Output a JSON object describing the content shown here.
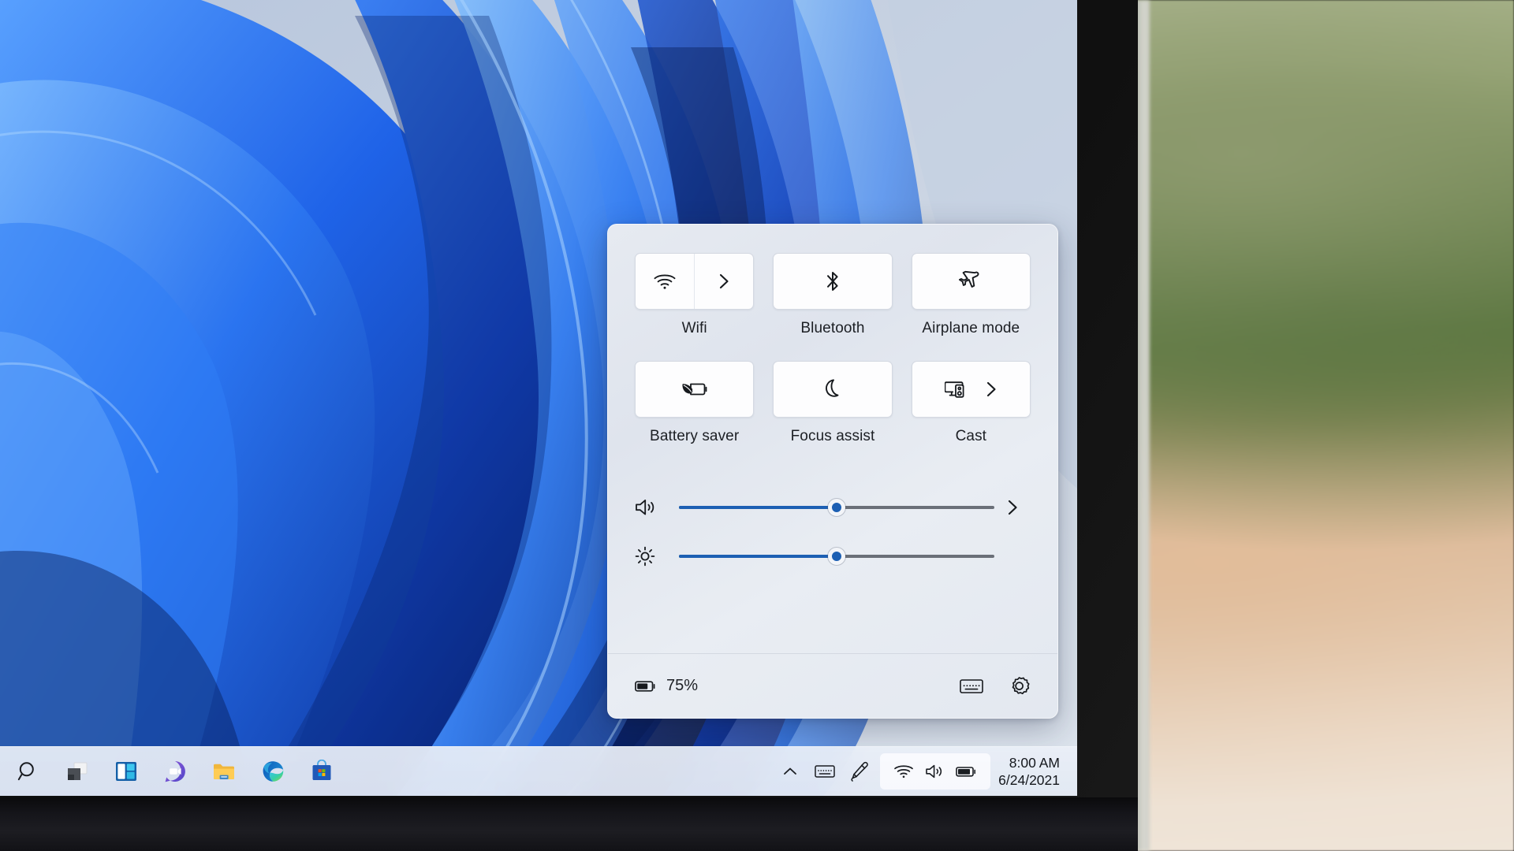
{
  "quick_settings": {
    "tiles": [
      {
        "label": "Wifi",
        "icon": "wifi-icon",
        "has_chevron": true,
        "style": "split",
        "state": "on"
      },
      {
        "label": "Bluetooth",
        "icon": "bluetooth-icon",
        "has_chevron": false,
        "style": "plain",
        "state": "on"
      },
      {
        "label": "Airplane mode",
        "icon": "airplane-icon",
        "has_chevron": false,
        "style": "plain",
        "state": "off"
      },
      {
        "label": "Battery saver",
        "icon": "battery-saver-icon",
        "has_chevron": false,
        "style": "plain",
        "state": "off"
      },
      {
        "label": "Focus assist",
        "icon": "moon-icon",
        "has_chevron": false,
        "style": "plain",
        "state": "off"
      },
      {
        "label": "Cast",
        "icon": "cast-icon",
        "has_chevron": true,
        "style": "cast",
        "state": "off"
      }
    ],
    "sliders": [
      {
        "name": "volume",
        "icon": "speaker-icon",
        "value": 50,
        "has_chevron": true
      },
      {
        "name": "brightness",
        "icon": "brightness-icon",
        "value": 50,
        "has_chevron": false
      }
    ],
    "footer": {
      "battery_icon": "battery-icon",
      "battery_percent": "75%",
      "keyboard_label": "keyboard-icon",
      "settings_label": "gear-icon"
    },
    "colors": {
      "accent": "#1c5fb3",
      "track": "#6a6f78",
      "tile_bg": "#fdfdfe",
      "panel_bg": "#e3e8f0"
    }
  },
  "taskbar": {
    "items": [
      {
        "name": "search",
        "label": "Search"
      },
      {
        "name": "task-view",
        "label": "Task view"
      },
      {
        "name": "widgets",
        "label": "Widgets"
      },
      {
        "name": "chat",
        "label": "Chat"
      },
      {
        "name": "file-explorer",
        "label": "File Explorer"
      },
      {
        "name": "edge",
        "label": "Microsoft Edge"
      },
      {
        "name": "store",
        "label": "Microsoft Store"
      }
    ],
    "tray": {
      "overflow": "show-hidden-icons",
      "touch_keyboard": "touch-keyboard-icon",
      "pen": "pen-icon",
      "group": [
        {
          "name": "wifi",
          "label": "Network"
        },
        {
          "name": "volume",
          "label": "Volume"
        },
        {
          "name": "battery",
          "label": "Battery"
        }
      ]
    },
    "clock": {
      "time": "8:00 AM",
      "date": "6/24/2021"
    }
  }
}
